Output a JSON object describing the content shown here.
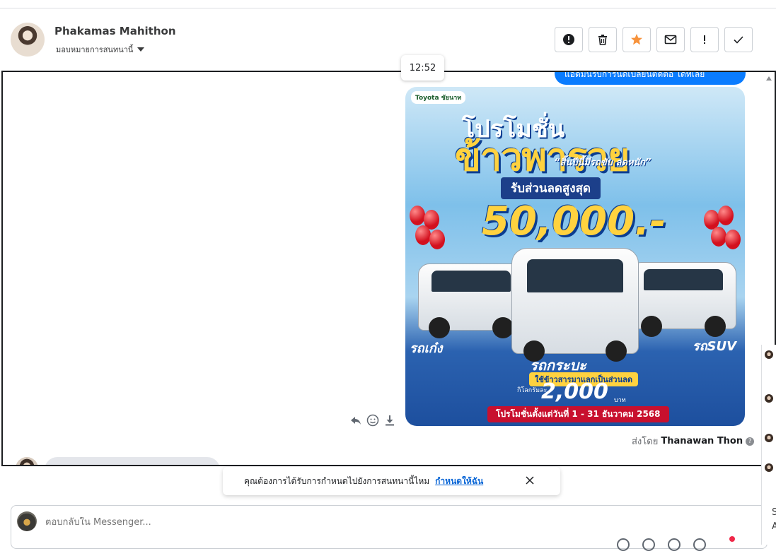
{
  "header": {
    "contact_name": "Phakamas Mahithon",
    "assign_label": "มอบหมายการสนทนานี้",
    "actions": [
      {
        "name": "spam-button",
        "icon": "exclamation-circle-icon"
      },
      {
        "name": "delete-button",
        "icon": "trash-icon"
      },
      {
        "name": "follow-up-button",
        "icon": "star-icon"
      },
      {
        "name": "mark-unread-button",
        "icon": "envelope-icon"
      },
      {
        "name": "priority-button",
        "icon": "exclamation-icon"
      },
      {
        "name": "mark-done-button",
        "icon": "check-icon"
      }
    ],
    "star_color": "#f7923b"
  },
  "chat": {
    "tooltip_time": "12:52",
    "previous_bubble_text": "แอดมินรับการนัดเปลี่ยนติดต่อ ได้ที่เลย",
    "promo": {
      "brand": "Toyota ชัยนาท",
      "title_line1": "โปรโมชั่น",
      "title_line2": "ข้าวพารวย",
      "tagline": "“สิ้นปีนี้มีรถขับ ลดหนัก”",
      "discount_label": "รับส่วนลดสูงสุด",
      "discount_value": "50,000.-",
      "sedan_label": "รถเก๋ง",
      "suv_label": "รถSUV",
      "pickup_label": "รถกระบะ",
      "rice_tag": "ใช้ข้าวสารมาแลกเป็นส่วนลด",
      "per_kg": "กิโลกรัมละ",
      "kg_value": "2,000",
      "baht": "บาท",
      "date_text": "โปรโมชั่นตั้งแต่วันที่ 1 - 31 ธันวาคม 2568"
    },
    "sent_by_prefix": "ส่งโดย",
    "sent_by_name": "Thanawan Thon",
    "help_glyph": "?"
  },
  "toast": {
    "message": "คุณต้องการได้รับการกำหนดไปยังการสนทนานี้ไหม",
    "link": "กำหนดให้ฉัน"
  },
  "reply": {
    "placeholder": "ตอบกลับใน Messenger..."
  },
  "right_rail": {
    "text_s": "S",
    "text_a": "A"
  },
  "colors": {
    "accent_blue": "#0a7cff",
    "link_blue": "#0a66d6",
    "promo_red": "#c8102e"
  }
}
